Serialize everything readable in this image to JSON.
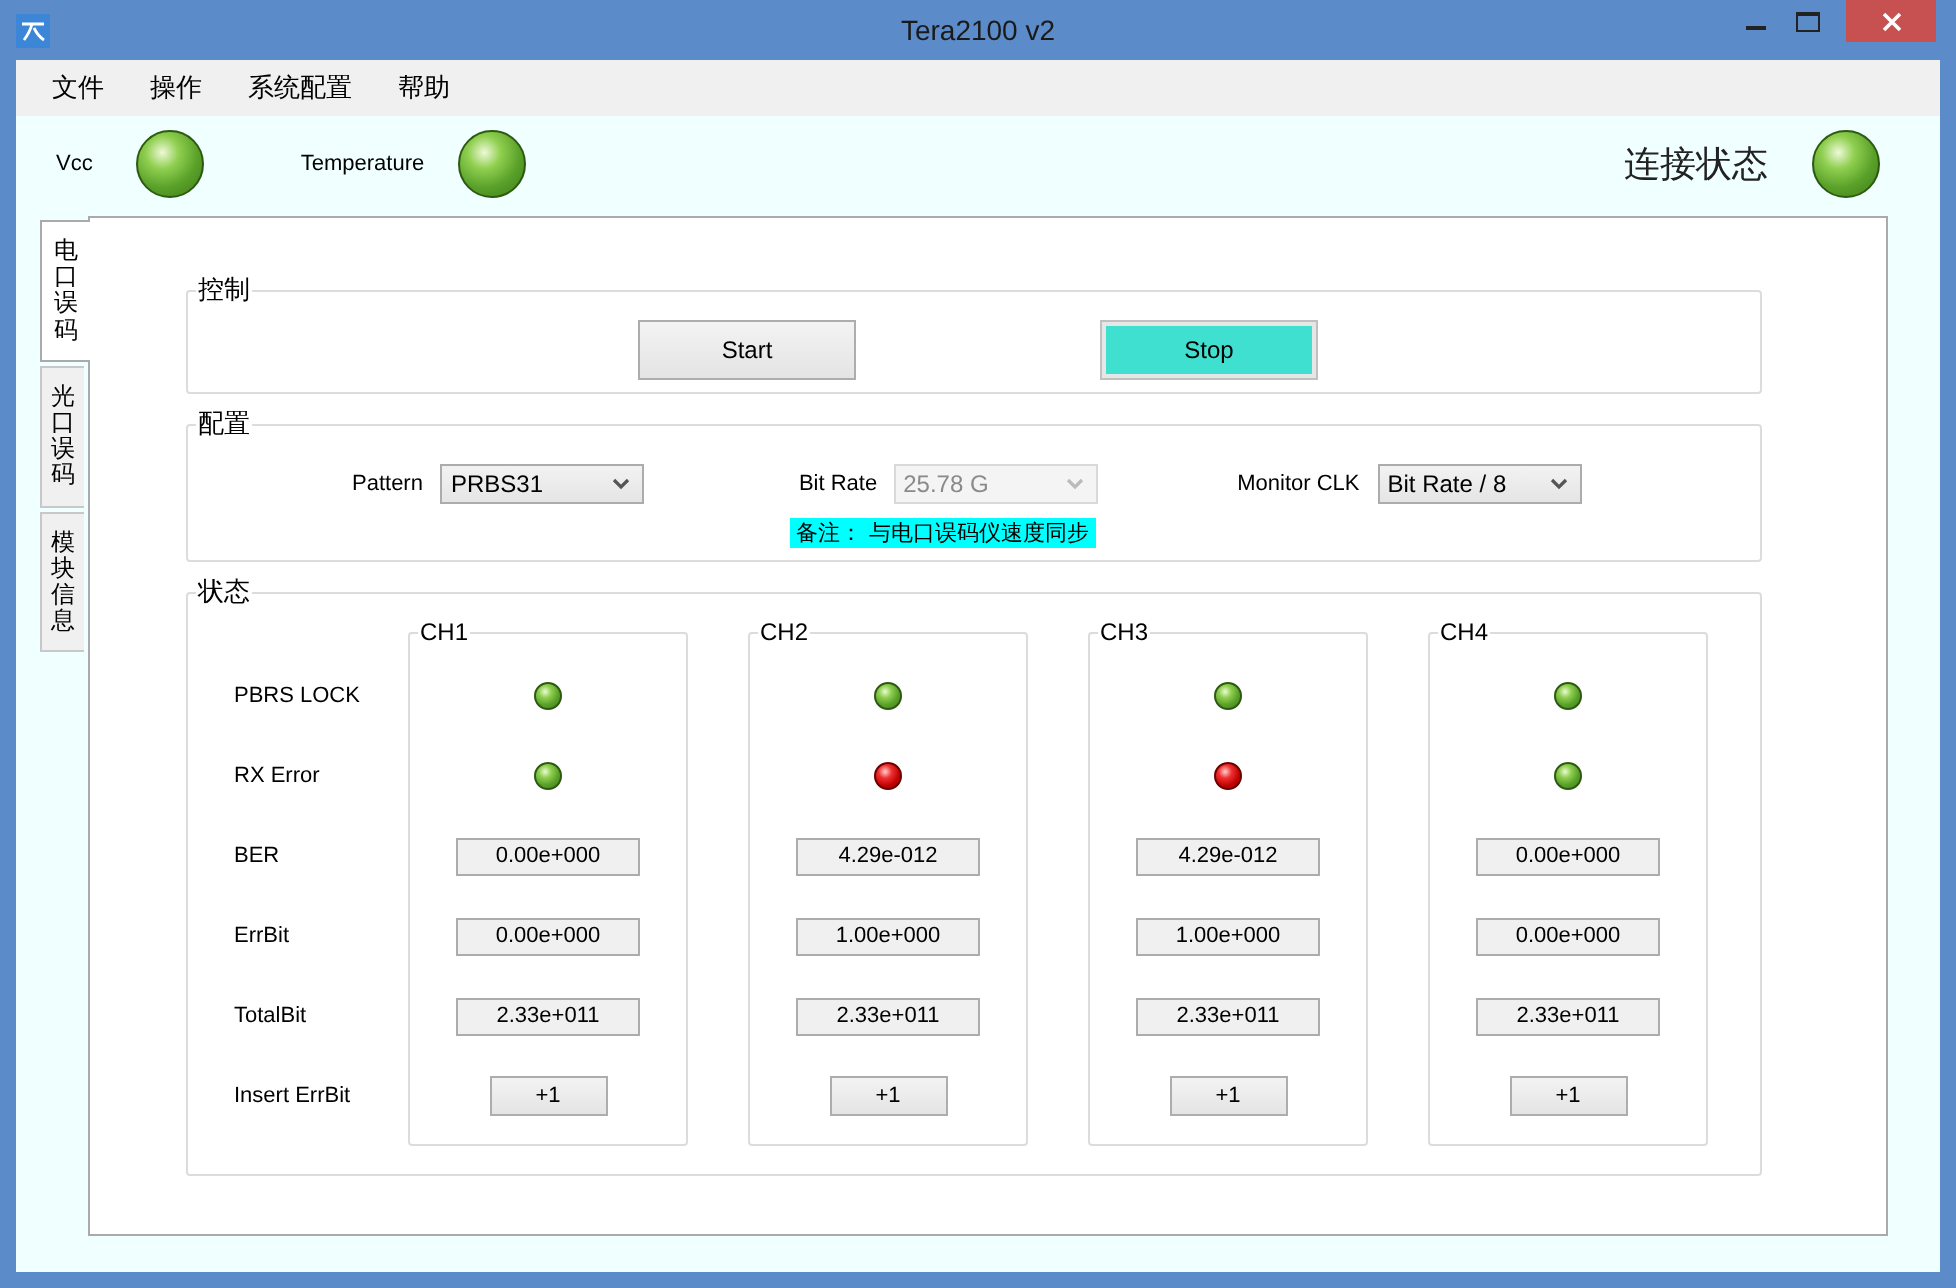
{
  "window": {
    "title": "Tera2100 v2"
  },
  "menu": [
    "文件",
    "操作",
    "系统配置",
    "帮助"
  ],
  "indicators": [
    {
      "label": "Vcc",
      "ok": true
    },
    {
      "label": "Temperature",
      "ok": true
    }
  ],
  "connection": {
    "label": "连接状态",
    "ok": true
  },
  "tabs": [
    {
      "label": "电口误码",
      "selected": true
    },
    {
      "label": "光口误码",
      "selected": false
    },
    {
      "label": "模块信息",
      "selected": false
    }
  ],
  "control": {
    "title": "控制",
    "buttons": [
      {
        "label": "Start",
        "active": false
      },
      {
        "label": "Stop",
        "active": true
      }
    ]
  },
  "config": {
    "title": "配置",
    "fields": [
      {
        "label": "Pattern",
        "value": "PRBS31",
        "disabled": false
      },
      {
        "label": "Bit Rate",
        "value": "25.78 G",
        "disabled": true
      },
      {
        "label": "Monitor CLK",
        "value": "Bit Rate / 8",
        "disabled": false
      }
    ],
    "note": "备注： 与电口误码仪速度同步"
  },
  "status": {
    "title": "状态",
    "row_labels": [
      "PBRS LOCK",
      "RX Error",
      "BER",
      "ErrBit",
      "TotalBit",
      "Insert ErrBit"
    ],
    "channels": [
      {
        "name": "CH1",
        "pbrs_lock_ok": true,
        "rx_error_ok": true,
        "ber": "0.00e+000",
        "errbit": "0.00e+000",
        "totalbit": "2.33e+011",
        "insert": "+1"
      },
      {
        "name": "CH2",
        "pbrs_lock_ok": true,
        "rx_error_ok": false,
        "ber": "4.29e-012",
        "errbit": "1.00e+000",
        "totalbit": "2.33e+011",
        "insert": "+1"
      },
      {
        "name": "CH3",
        "pbrs_lock_ok": true,
        "rx_error_ok": false,
        "ber": "4.29e-012",
        "errbit": "1.00e+000",
        "totalbit": "2.33e+011",
        "insert": "+1"
      },
      {
        "name": "CH4",
        "pbrs_lock_ok": true,
        "rx_error_ok": true,
        "ber": "0.00e+000",
        "errbit": "0.00e+000",
        "totalbit": "2.33e+011",
        "insert": "+1"
      }
    ]
  }
}
